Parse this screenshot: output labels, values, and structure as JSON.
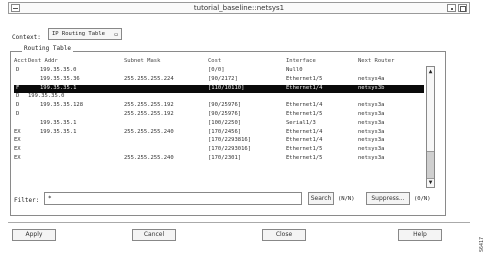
{
  "window": {
    "title": "tutorial_baseline::netsys1"
  },
  "context": {
    "label": "Context:",
    "value": "IP Routing Table"
  },
  "group": {
    "label": "Routing Table"
  },
  "columns": [
    "Acct",
    "Dest Addr",
    "Subnet Mask",
    "Cost",
    "Interface",
    "Next Router"
  ],
  "rows": [
    {
      "acct": "D",
      "dest": "199.35.35.0",
      "mask": "",
      "cost": "[0/0]",
      "iface": "Null0",
      "next": "",
      "selected": false
    },
    {
      "acct": "",
      "dest": "199.35.35.36",
      "mask": "255.255.255.224",
      "cost": "[90/2172]",
      "iface": "Ethernet1/5",
      "next": "netsys4a",
      "selected": false
    },
    {
      "acct": "F",
      "dest": "199.35.35.1",
      "mask": "",
      "cost": "[110/10110]",
      "iface": "Ethernet1/4",
      "next": "netsys3b",
      "selected": true
    },
    {
      "acct": "D",
      "dest": "199.35.35.0",
      "mask": "",
      "cost": "",
      "iface": "",
      "next": "",
      "selected": false
    },
    {
      "acct": "D",
      "dest": "199.35.35.128",
      "mask": "255.255.255.192",
      "cost": "[90/25976]",
      "iface": "Ethernet1/4",
      "next": "netsys3a",
      "selected": false
    },
    {
      "acct": "D",
      "dest": "",
      "mask": "255.255.255.192",
      "cost": "[90/25976]",
      "iface": "Ethernet1/5",
      "next": "netsys3a",
      "selected": false
    },
    {
      "acct": "",
      "dest": "199.35.35.1",
      "mask": "",
      "cost": "[100/2250]",
      "iface": "Serial1/3",
      "next": "netsys3a",
      "selected": false
    },
    {
      "acct": "EX",
      "dest": "199.35.35.1",
      "mask": "255.255.255.240",
      "cost": "[170/2456]",
      "iface": "Ethernet1/4",
      "next": "netsys3a",
      "selected": false
    },
    {
      "acct": "EX",
      "dest": "",
      "mask": "",
      "cost": "[170/2293816]",
      "iface": "Ethernet1/4",
      "next": "netsys3a",
      "selected": false
    },
    {
      "acct": "EX",
      "dest": "",
      "mask": "",
      "cost": "[170/2293016]",
      "iface": "Ethernet1/5",
      "next": "netsys3a",
      "selected": false
    },
    {
      "acct": "EX",
      "dest": "",
      "mask": "255.255.255.240",
      "cost": "[170/2301]",
      "iface": "Ethernet1/5",
      "next": "netsys3a",
      "selected": false
    }
  ],
  "filter": {
    "label": "Filter:",
    "value": "*"
  },
  "buttons": {
    "search": "Search",
    "search_count": "(N/N)",
    "suppress": "Suppress...",
    "suppress_count": "(0/N)",
    "apply": "Apply",
    "cancel": "Cancel",
    "close": "Close",
    "help": "Help"
  },
  "figure_code": "S6417"
}
